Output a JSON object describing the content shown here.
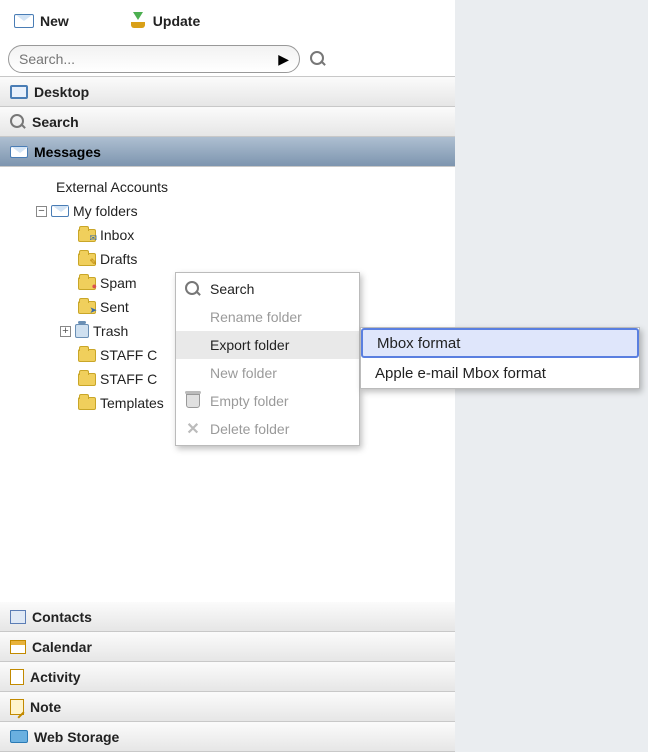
{
  "toolbar": {
    "new_label": "New",
    "update_label": "Update"
  },
  "search": {
    "placeholder": "Search..."
  },
  "accordion": {
    "desktop": "Desktop",
    "search": "Search",
    "messages": "Messages",
    "contacts": "Contacts",
    "calendar": "Calendar",
    "activity": "Activity",
    "note": "Note",
    "webstorage": "Web Storage"
  },
  "tree": {
    "external": "External Accounts",
    "myfolders": "My folders",
    "inbox": "Inbox",
    "drafts": "Drafts",
    "spam": "Spam",
    "sent": "Sent",
    "trash": "Trash",
    "staff1": "STAFF C",
    "staff2": "STAFF C",
    "templates": "Templates"
  },
  "ctx": {
    "search": "Search",
    "rename": "Rename folder",
    "export": "Export folder",
    "newf": "New folder",
    "empty": "Empty folder",
    "delete": "Delete folder"
  },
  "submenu": {
    "mbox": "Mbox format",
    "apple": "Apple e-mail Mbox format"
  }
}
